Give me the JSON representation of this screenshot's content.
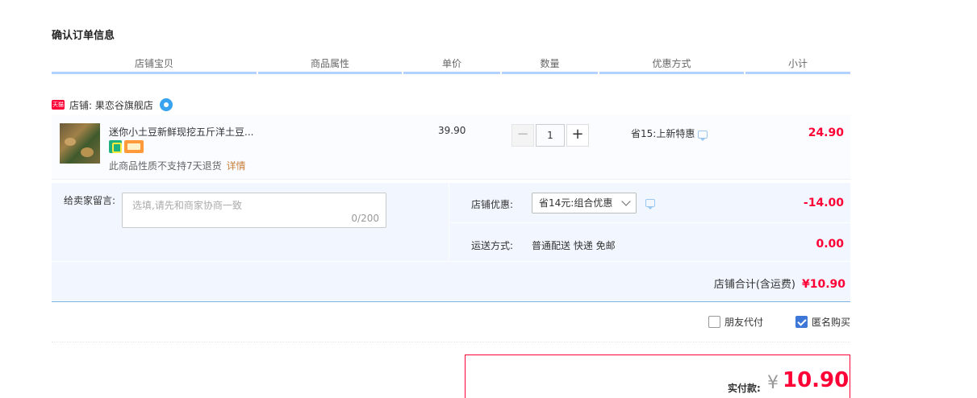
{
  "page_title": "确认订单信息",
  "columns": [
    "店铺宝贝",
    "商品属性",
    "单价",
    "数量",
    "优惠方式",
    "小计"
  ],
  "shop": {
    "badge": "天猫",
    "label": "店铺: 果恋谷旗舰店"
  },
  "item": {
    "title": "迷你小土豆新鲜现挖五斤洋土豆...",
    "return_note": "此商品性质不支持7天退货",
    "return_detail": "详情",
    "unit_price": "39.90",
    "quantity": "1",
    "qty_minus": "−",
    "qty_plus": "+",
    "promo": "省15:上新特惠",
    "subtotal": "24.90"
  },
  "memo": {
    "label": "给卖家留言:",
    "placeholder": "选填,请先和商家协商一致",
    "count": "0/200"
  },
  "shop_discount": {
    "label": "店铺优惠:",
    "selected": "省14元:组合优惠",
    "amount": "-14.00"
  },
  "shipping": {
    "label": "运送方式:",
    "value": "普通配送 快递 免邮",
    "amount": "0.00"
  },
  "shop_total": {
    "label": "店铺合计(含运费)",
    "value": "¥10.90"
  },
  "options": {
    "friend_pay": "朋友代付",
    "friend_pay_checked": false,
    "anonymous": "匿名购买",
    "anonymous_checked": true
  },
  "payment": {
    "label": "实付款:",
    "currency": "¥",
    "amount": "10.90"
  },
  "colors": {
    "accent_red": "#ff0036",
    "header_blue": "#b2d1ff",
    "panel_bg": "#f2f7ff",
    "checkbox_blue": "#3d78d8"
  }
}
